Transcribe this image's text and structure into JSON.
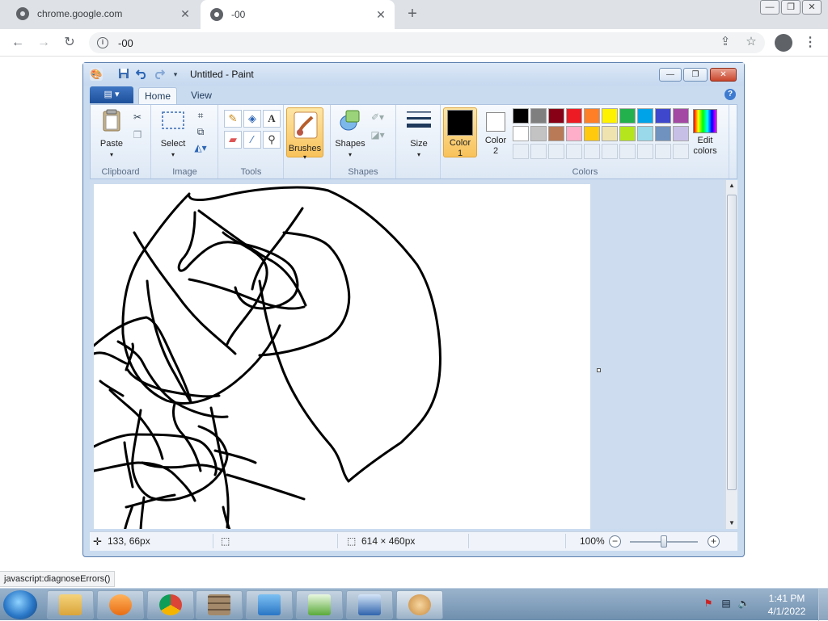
{
  "browser": {
    "tabs": [
      {
        "title": "chrome.google.com",
        "close": "✕"
      },
      {
        "title": "-00",
        "close": "✕"
      }
    ],
    "new_tab": "+",
    "window_controls": [
      "—",
      "❐",
      "✕"
    ],
    "nav": {
      "back": "←",
      "forward": "→",
      "reload": "↻"
    },
    "address": "-00",
    "info_icon": "i",
    "share": "⇪",
    "bookmark": "☆",
    "menu": "⋮",
    "status_bubble": "javascript:diagnoseErrors()"
  },
  "paint": {
    "title": "Untitled - Paint",
    "quick_access": [
      "save-icon",
      "undo-icon",
      "redo-icon",
      "customize-icon"
    ],
    "window_controls": [
      "—",
      "❐",
      "✕"
    ],
    "file_button": "▤ ▾",
    "tabs": [
      "Home",
      "View"
    ],
    "help": "?",
    "groups": {
      "clipboard": {
        "label": "Clipboard",
        "paste": "Paste"
      },
      "image": {
        "label": "Image",
        "select": "Select"
      },
      "tools": {
        "label": "Tools"
      },
      "brushes": {
        "label": "Brushes"
      },
      "shapes": {
        "label": "Shapes",
        "shapes_btn": "Shapes"
      },
      "size": {
        "label": "Size"
      },
      "colors": {
        "label": "Colors",
        "color1": "Color\n1",
        "color1_a": "Color",
        "color1_b": "1",
        "color2_a": "Color",
        "color2_b": "2",
        "edit_a": "Edit",
        "edit_b": "colors",
        "color1_value": "#000000",
        "color2_value": "#ffffff",
        "palette_row1": [
          "#000000",
          "#7f7f7f",
          "#880015",
          "#ed1c24",
          "#ff7f27",
          "#fff200",
          "#22b14c",
          "#00a2e8",
          "#3f48cc",
          "#a349a4"
        ],
        "palette_row2": [
          "#ffffff",
          "#c3c3c3",
          "#b97a57",
          "#ffaec9",
          "#ffc90e",
          "#efe4b0",
          "#b5e61d",
          "#99d9ea",
          "#7092be",
          "#c8bfe7"
        ]
      }
    },
    "status": {
      "cursor_pos": "133, 66px",
      "canvas_size": "614 × 460px",
      "zoom": "100%"
    }
  },
  "taskbar": {
    "time": "1:41 PM",
    "date": "4/1/2022",
    "apps": [
      "explorer-icon",
      "media-player-icon",
      "chrome-icon",
      "firewall-icon",
      "control-panel-icon",
      "notepad-icon",
      "remote-desktop-icon",
      "paint-icon"
    ]
  }
}
